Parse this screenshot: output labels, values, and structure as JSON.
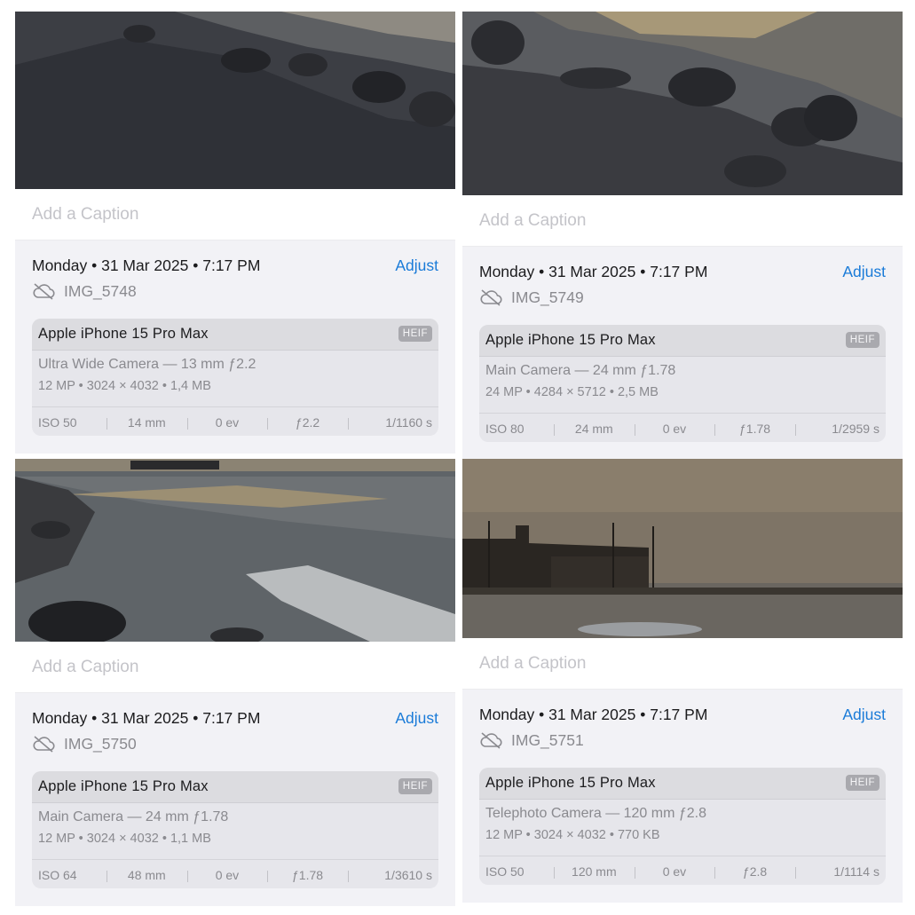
{
  "caption_placeholder": "Add a Caption",
  "adjust_label": "Adjust",
  "cards": [
    {
      "datetime": "Monday • 31 Mar 2025 • 7:17 PM",
      "filename": "IMG_5748",
      "device": "Apple iPhone 15 Pro Max",
      "format": "HEIF",
      "lens": "Ultra Wide Camera — 13 mm ƒ2.2",
      "specs": "12 MP • 3024 × 4032 • 1,4 MB",
      "iso": "ISO 50",
      "focal": "14 mm",
      "ev": "0 ev",
      "aperture": "ƒ2.2",
      "shutter": "1/1160 s"
    },
    {
      "datetime": "Monday • 31 Mar 2025 • 7:17 PM",
      "filename": "IMG_5749",
      "device": "Apple iPhone 15 Pro Max",
      "format": "HEIF",
      "lens": "Main Camera — 24 mm ƒ1.78",
      "specs": "24 MP • 4284 × 5712 • 2,5 MB",
      "iso": "ISO 80",
      "focal": "24 mm",
      "ev": "0 ev",
      "aperture": "ƒ1.78",
      "shutter": "1/2959 s"
    },
    {
      "datetime": "Monday • 31 Mar 2025 • 7:17 PM",
      "filename": "IMG_5750",
      "device": "Apple iPhone 15 Pro Max",
      "format": "HEIF",
      "lens": "Main Camera — 24 mm ƒ1.78",
      "specs": "12 MP • 3024 × 4032 • 1,1 MB",
      "iso": "ISO 64",
      "focal": "48 mm",
      "ev": "0 ev",
      "aperture": "ƒ1.78",
      "shutter": "1/3610 s"
    },
    {
      "datetime": "Monday • 31 Mar 2025 • 7:17 PM",
      "filename": "IMG_5751",
      "device": "Apple iPhone 15 Pro Max",
      "format": "HEIF",
      "lens": "Telephoto Camera — 120 mm ƒ2.8",
      "specs": "12 MP • 3024 × 4032 • 770 KB",
      "iso": "ISO 50",
      "focal": "120 mm",
      "ev": "0 ev",
      "aperture": "ƒ2.8",
      "shutter": "1/1114 s"
    }
  ]
}
